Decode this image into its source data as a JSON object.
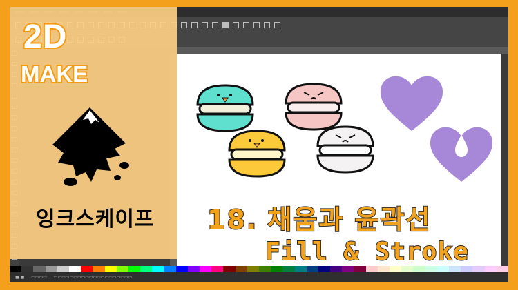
{
  "brand": {
    "logo_line1": "2D",
    "logo_line2": "MAKE"
  },
  "app": {
    "name_label": "잉크스케이프"
  },
  "title": {
    "number": "18.",
    "korean": "채움과 윤곽선",
    "english": "Fill & Stroke"
  },
  "colors": {
    "background_orange": "#f39c12",
    "panel_cream": "#fccd82",
    "heart_purple": "#a787d8",
    "macaron_teal": "#5fe0cf",
    "macaron_yellow": "#fbc93a",
    "macaron_pink": "#f6c6c4",
    "macaron_white": "#f5f2f4"
  },
  "icons": [
    "inkscape-logo-icon",
    "heart-icon",
    "heart-drop-icon",
    "macaron-icon"
  ],
  "palette": [
    "#000000",
    "#333333",
    "#666666",
    "#999999",
    "#cccccc",
    "#ffffff",
    "#ff0000",
    "#ff7f00",
    "#ffff00",
    "#7fff00",
    "#00ff00",
    "#00ff7f",
    "#00ffff",
    "#007fff",
    "#0000ff",
    "#7f00ff",
    "#ff00ff",
    "#ff007f",
    "#800000",
    "#804000",
    "#808000",
    "#408000",
    "#008000",
    "#008040",
    "#008080",
    "#004080",
    "#000080",
    "#400080",
    "#800080",
    "#800040",
    "#ffcccc",
    "#ffe5cc",
    "#ffffcc",
    "#e5ffcc",
    "#ccffcc",
    "#ccffe5",
    "#ccffff",
    "#cce5ff",
    "#ccccff",
    "#e5ccff",
    "#ffccff",
    "#ffcce5"
  ]
}
